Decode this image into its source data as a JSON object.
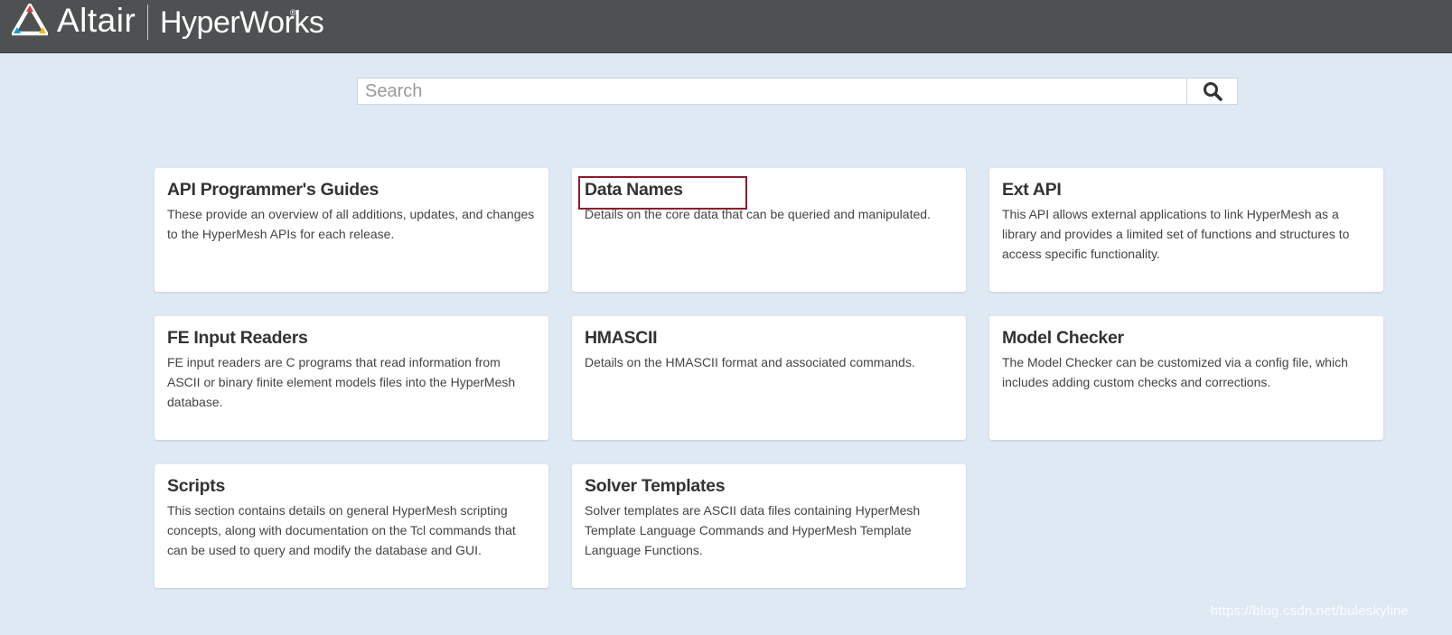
{
  "header": {
    "brand_altair": "Altair",
    "brand_product": "HyperWorks",
    "brand_reg": "®",
    "background_color": "#4d5152"
  },
  "search": {
    "placeholder": "Search",
    "value": "",
    "button_icon": "search-icon"
  },
  "cards": [
    {
      "title": "API Programmer's Guides",
      "description": "These provide an overview of all additions, updates, and changes to the HyperMesh APIs for each release."
    },
    {
      "title": "Data Names",
      "description": "Details on the core data that can be queried and manipulated."
    },
    {
      "title": "Ext API",
      "description": "This API allows external applications to link HyperMesh as a library and provides a limited set of functions and structures to access specific functionality."
    },
    {
      "title": "FE Input Readers",
      "description": "FE input readers are C programs that read information from ASCII or binary finite element models files into the HyperMesh database."
    },
    {
      "title": "HMASCII",
      "description": "Details on the HMASCII format and associated commands."
    },
    {
      "title": "Model Checker",
      "description": "The Model Checker can be customized via a config file, which includes adding custom checks and corrections."
    },
    {
      "title": "Scripts",
      "description": "This section contains details on general HyperMesh scripting concepts, along with documentation on the Tcl commands that can be used to query and modify the database and GUI."
    },
    {
      "title": "Solver Templates",
      "description": "Solver templates are ASCII data files containing HyperMesh Template Language Commands and HyperMesh Template Language Functions."
    }
  ],
  "watermark": "https://blog.csdn.net/buleskyline",
  "colors": {
    "page_background": "#dfe9f4",
    "highlight_border": "#8b1d2c",
    "card_background": "#ffffff"
  }
}
